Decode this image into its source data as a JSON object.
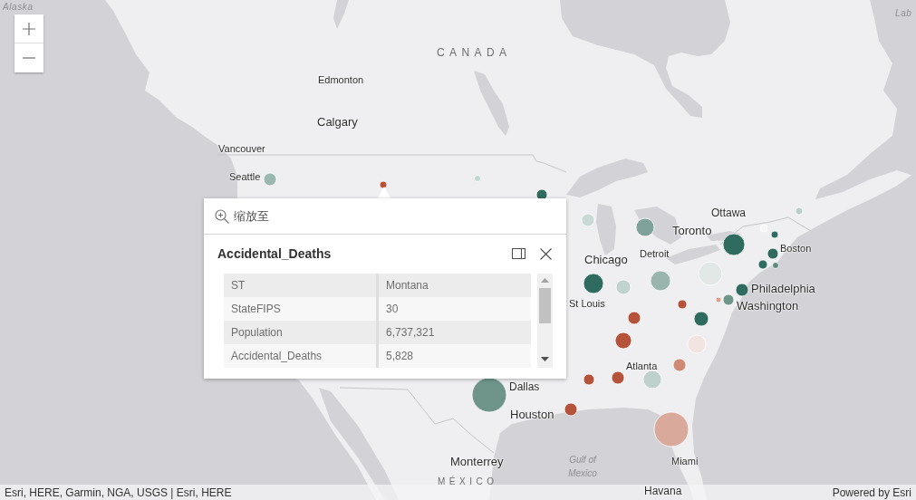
{
  "map": {
    "labels": [
      {
        "text": "Alaska",
        "kind": "region"
      },
      {
        "text": "Lab",
        "kind": "region"
      },
      {
        "text": "CANADA",
        "kind": "country"
      },
      {
        "text": "Edmonton",
        "kind": "city"
      },
      {
        "text": "Calgary",
        "kind": "city"
      },
      {
        "text": "Vancouver",
        "kind": "city"
      },
      {
        "text": "Seattle",
        "kind": "city"
      },
      {
        "text": "Ottawa",
        "kind": "city"
      },
      {
        "text": "Toronto",
        "kind": "city"
      },
      {
        "text": "Boston",
        "kind": "city"
      },
      {
        "text": "Detroit",
        "kind": "city"
      },
      {
        "text": "Chicago",
        "kind": "city"
      },
      {
        "text": "Philadelphia",
        "kind": "city"
      },
      {
        "text": "St Louis",
        "kind": "city"
      },
      {
        "text": "Washington",
        "kind": "city"
      },
      {
        "text": "Atlanta",
        "kind": "city"
      },
      {
        "text": "Dallas",
        "kind": "city"
      },
      {
        "text": "Houston",
        "kind": "city"
      },
      {
        "text": "Monterrey",
        "kind": "city"
      },
      {
        "text": "Gulf of Mexico",
        "kind": "water"
      },
      {
        "text": "Miami",
        "kind": "city"
      },
      {
        "text": "MÉXICO",
        "kind": "country"
      },
      {
        "text": "Havana",
        "kind": "city"
      }
    ],
    "points": [
      {
        "color": "#9bb8b0"
      },
      {
        "color": "#b5533a"
      },
      {
        "color": "#c5d6d1"
      },
      {
        "color": "#2f6b5e"
      },
      {
        "color": "#c9d9d4"
      },
      {
        "color": "#7fa39a"
      },
      {
        "color": "#2f6b5e"
      },
      {
        "color": "#f7f7f7"
      },
      {
        "color": "#2f6b5e"
      },
      {
        "color": "#b8cec8"
      },
      {
        "color": "#2f6b5e"
      },
      {
        "color": "#2f6b5e"
      },
      {
        "color": "#5e8d80"
      },
      {
        "color": "#2f6b5e"
      },
      {
        "color": "#c0d3ce"
      },
      {
        "color": "#9ab5ae"
      },
      {
        "color": "#e1e8e6"
      },
      {
        "color": "#2f6b5e"
      },
      {
        "color": "#6f968b"
      },
      {
        "color": "#e0a08e"
      },
      {
        "color": "#b5533a"
      },
      {
        "color": "#2f6b5e"
      },
      {
        "color": "#b5533a"
      },
      {
        "color": "#b5533a"
      },
      {
        "color": "#f2e4e0"
      },
      {
        "color": "#cf8a75"
      },
      {
        "color": "#bfd1cc"
      },
      {
        "color": "#b5533a"
      },
      {
        "color": "#b5533a"
      },
      {
        "color": "#6f958a"
      },
      {
        "color": "#b5533a"
      },
      {
        "color": "#d9a99b"
      }
    ]
  },
  "popup": {
    "action": "缩放至",
    "title": "Accidental_Deaths",
    "fields": [
      {
        "name": "ST",
        "value": "Montana"
      },
      {
        "name": "StateFIPS",
        "value": "30"
      },
      {
        "name": "Population",
        "value": "6,737,321"
      },
      {
        "name": "Accidental_Deaths",
        "value": "5,828"
      }
    ]
  },
  "attribution": {
    "sources": "Esri, HERE, Garmin, NGA, USGS | Esri, HERE",
    "powered_by": "Powered by Esri"
  }
}
